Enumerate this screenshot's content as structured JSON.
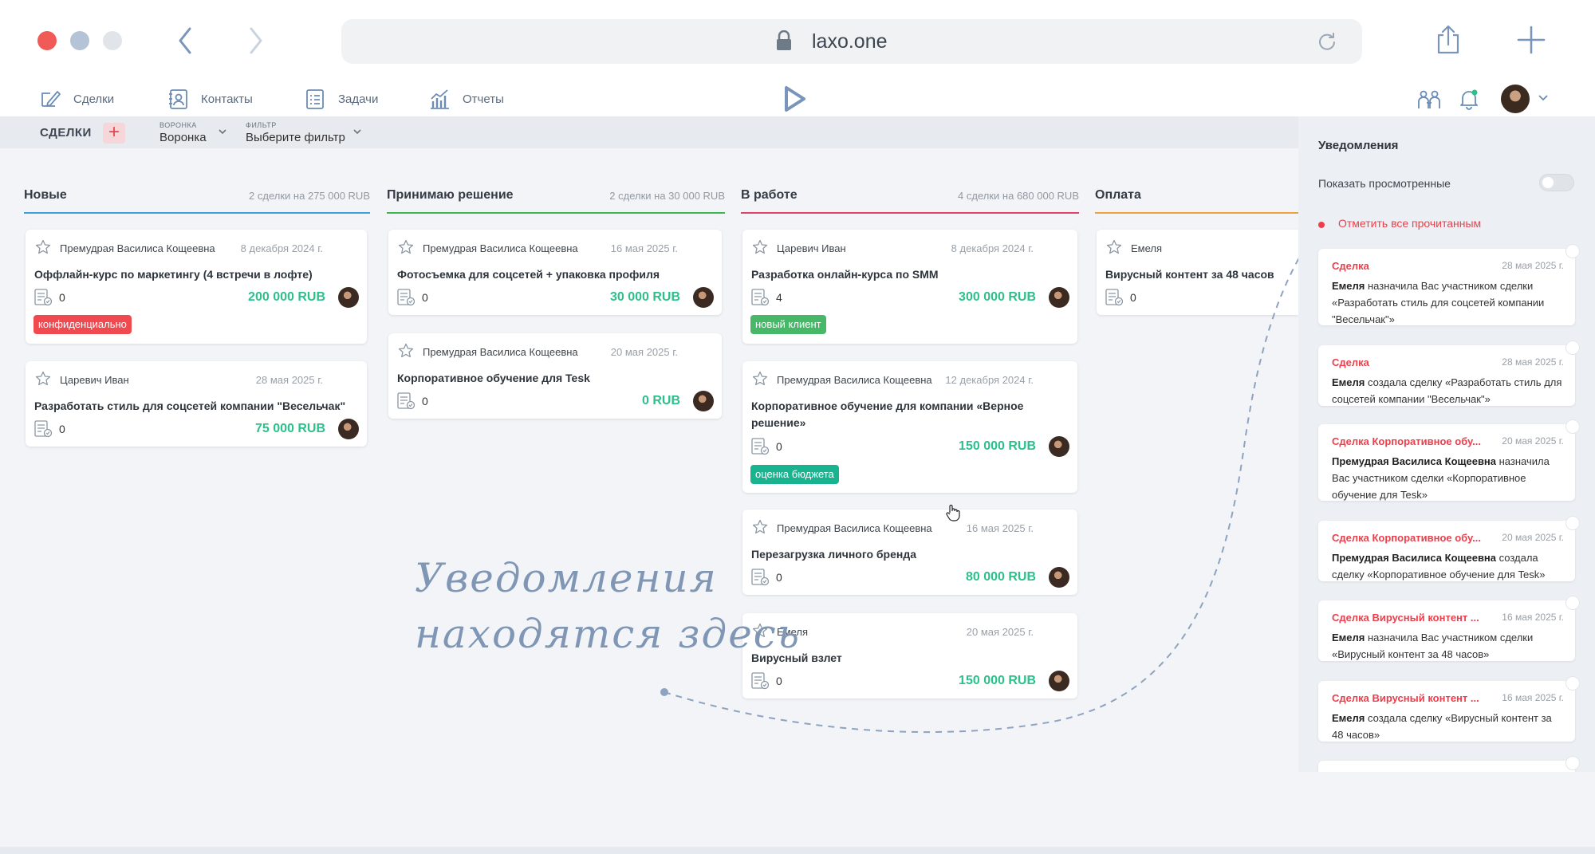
{
  "browser": {
    "url": "laxo.one"
  },
  "nav": {
    "items": [
      {
        "label": "Сделки",
        "icon": "deals-icon"
      },
      {
        "label": "Контакты",
        "icon": "contacts-icon"
      },
      {
        "label": "Задачи",
        "icon": "tasks-icon"
      },
      {
        "label": "Отчеты",
        "icon": "reports-icon"
      }
    ]
  },
  "toolbar": {
    "title": "СДЕЛКИ",
    "add": "+",
    "funnel_label": "ВОРОНКА",
    "funnel_value": "Воронка",
    "filter_label": "ФИЛЬТР",
    "filter_value": "Выберите фильтр"
  },
  "colors": {
    "new": "#3ca2dd",
    "deciding": "#3db84f",
    "inwork": "#e0426a",
    "payment": "#f0a13a",
    "amount": "#2cc08b",
    "tag_red": "#f04a50",
    "tag_green": "#46b868",
    "tag_teal": "#1ab38f"
  },
  "columns": [
    {
      "title": "Новые",
      "summary": "2 сделки на 275 000 RUB",
      "cards": [
        {
          "owner": "Премудрая Василиса Кощеевна",
          "date": "8 декабря 2024 г.",
          "title": "Оффлайн-курс по маркетингу (4 встречи в лофте)",
          "count": "0",
          "amount": "200 000 RUB",
          "tag": "конфиденциально"
        },
        {
          "owner": "Царевич Иван",
          "date": "28 мая 2025 г.",
          "title": "Разработать стиль для соцсетей компании \"Весельчак\"",
          "count": "0",
          "amount": "75 000 RUB"
        }
      ]
    },
    {
      "title": "Принимаю решение",
      "summary": "2 сделки на 30 000 RUB",
      "cards": [
        {
          "owner": "Премудрая Василиса Кощеевна",
          "date": "16 мая 2025 г.",
          "title": "Фотосъемка для соцсетей + упаковка профиля",
          "count": "0",
          "amount": "30 000 RUB"
        },
        {
          "owner": "Премудрая Василиса Кощеевна",
          "date": "20 мая 2025 г.",
          "title": "Корпоративное обучение для Tesk",
          "count": "0",
          "amount": "0 RUB"
        }
      ]
    },
    {
      "title": "В работе",
      "summary": "4 сделки на 680 000 RUB",
      "cards": [
        {
          "owner": "Царевич Иван",
          "date": "8 декабря 2024 г.",
          "title": "Разработка онлайн-курса по SMM",
          "count": "4",
          "amount": "300 000 RUB",
          "tag": "новый клиент"
        },
        {
          "owner": "Премудрая Василиса Кощеевна",
          "date": "12 декабря 2024 г.",
          "title": "Корпоративное обучение для компании «Верное решение»",
          "count": "0",
          "amount": "150 000 RUB",
          "tag": "оценка бюджета"
        },
        {
          "owner": "Премудрая Василиса Кощеевна",
          "date": "16 мая 2025 г.",
          "title": "Перезагрузка личного бренда",
          "count": "0",
          "amount": "80 000 RUB"
        },
        {
          "owner": "Емеля",
          "date": "20 мая 2025 г.",
          "title": "Вирусный взлет",
          "count": "0",
          "amount": "150 000 RUB"
        }
      ]
    },
    {
      "title": "Оплата",
      "cards": [
        {
          "owner": "Емеля",
          "title": "Вирусный контент за 48 часов",
          "count": "0"
        }
      ]
    }
  ],
  "annotation": {
    "line1": "Уведомления",
    "line2": "находятся здесь"
  },
  "notifications": {
    "title": "Уведомления",
    "show_viewed": "Показать просмотренные",
    "mark_all": "Отметить все прочитанным",
    "items": [
      {
        "title": "Сделка",
        "date": "28 мая 2025 г.",
        "actor": "Емеля",
        "text": " назначила Вас участником сделки «Разработать стиль для соцсетей компании \"Весельчак\"»"
      },
      {
        "title": "Сделка",
        "date": "28 мая 2025 г.",
        "actor": "Емеля",
        "text": " создала сделку «Разработать стиль для соцсетей компании \"Весельчак\"»"
      },
      {
        "title": "Сделка Корпоративное обу...",
        "date": "20 мая 2025 г.",
        "actor": "Премудрая Василиса Кощеевна",
        "text": " назначила Вас участником сделки «Корпоративное обучение для Tesk»"
      },
      {
        "title": "Сделка Корпоративное обу...",
        "date": "20 мая 2025 г.",
        "actor": "Премудрая Василиса Кощеевна",
        "text": " создала сделку «Корпоративное обучение для Tesk»"
      },
      {
        "title": "Сделка Вирусный контент ...",
        "date": "16 мая 2025 г.",
        "actor": "Емеля",
        "text": " назначила Вас участником сделки «Вирусный контент за 48 часов»"
      },
      {
        "title": "Сделка Вирусный контент ...",
        "date": "16 мая 2025 г.",
        "actor": "Емеля",
        "text": " создала сделку «Вирусный контент за 48 часов»"
      }
    ]
  }
}
